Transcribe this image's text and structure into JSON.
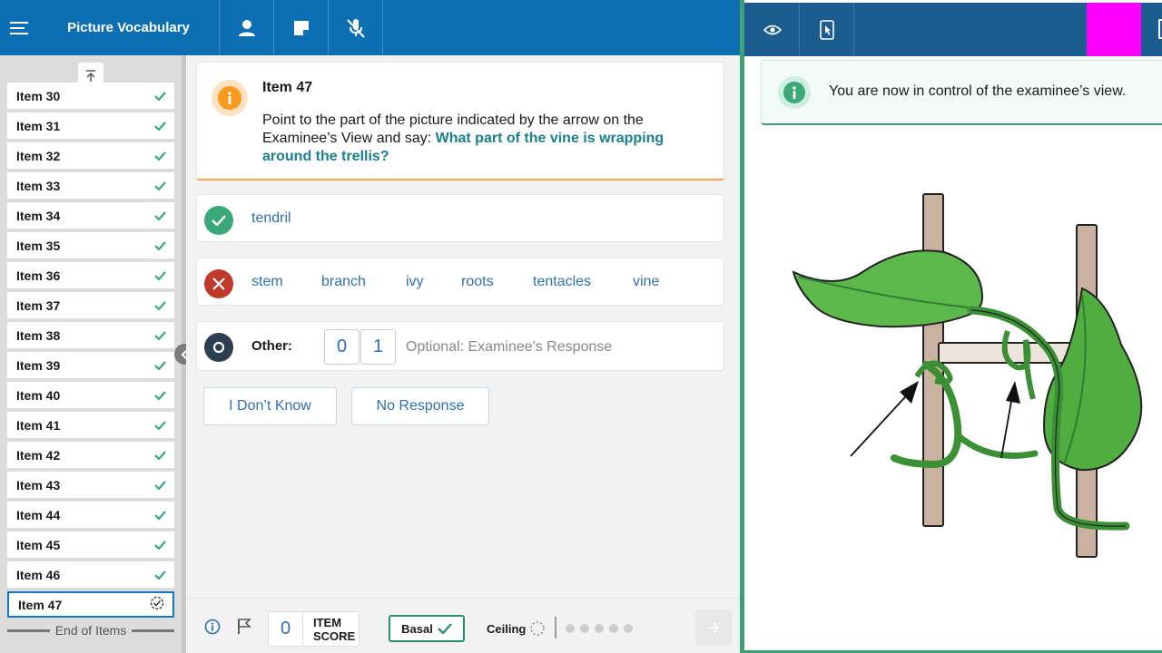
{
  "header": {
    "title": "Picture Vocabulary",
    "icons": [
      "menu-icon",
      "person-icon",
      "note-icon",
      "mic-off-icon"
    ]
  },
  "sidebar": {
    "items": [
      {
        "label": "Item 30",
        "status": "done"
      },
      {
        "label": "Item 31",
        "status": "done"
      },
      {
        "label": "Item 32",
        "status": "done"
      },
      {
        "label": "Item 33",
        "status": "done"
      },
      {
        "label": "Item 34",
        "status": "done"
      },
      {
        "label": "Item 35",
        "status": "done"
      },
      {
        "label": "Item 36",
        "status": "done"
      },
      {
        "label": "Item 37",
        "status": "done"
      },
      {
        "label": "Item 38",
        "status": "done"
      },
      {
        "label": "Item 39",
        "status": "done"
      },
      {
        "label": "Item 40",
        "status": "done"
      },
      {
        "label": "Item 41",
        "status": "done"
      },
      {
        "label": "Item 42",
        "status": "done"
      },
      {
        "label": "Item 43",
        "status": "done"
      },
      {
        "label": "Item 44",
        "status": "done"
      },
      {
        "label": "Item 45",
        "status": "done"
      },
      {
        "label": "Item 46",
        "status": "done"
      },
      {
        "label": "Item 47",
        "status": "current"
      }
    ],
    "end_label": "End of Items"
  },
  "question": {
    "title": "Item 47",
    "instruction": "Point to the part of the picture indicated by the arrow on the Examinee’s View and say: ",
    "prompt": "What part of the vine is wrapping around the trellis?"
  },
  "responses": {
    "correct": [
      "tendril"
    ],
    "incorrect": [
      "stem",
      "branch",
      "ivy",
      "roots",
      "tentacles",
      "vine"
    ],
    "other": {
      "label": "Other:",
      "score_0": "0",
      "score_1": "1",
      "placeholder": "Optional: Examinee's Response",
      "value": ""
    },
    "dont_know": "I Don’t Know",
    "no_response": "No Response"
  },
  "footer": {
    "item_score_value": "0",
    "item_score_label_1": "ITEM",
    "item_score_label_2": "SCORE",
    "basal_label": "Basal",
    "ceiling_label": "Ceiling",
    "ceiling_dots": 5
  },
  "examinee_view": {
    "notice": "You are now in control of the examinee’s view.",
    "icons": [
      "eye-icon",
      "tablet-pointer-icon"
    ]
  },
  "colors": {
    "header_blue": "#0c6fb4",
    "panel_blue": "#1a5d8e",
    "green": "#3f9e76",
    "orange": "#f79a1e",
    "red": "#c0392b",
    "magenta": "#ff00ff"
  }
}
